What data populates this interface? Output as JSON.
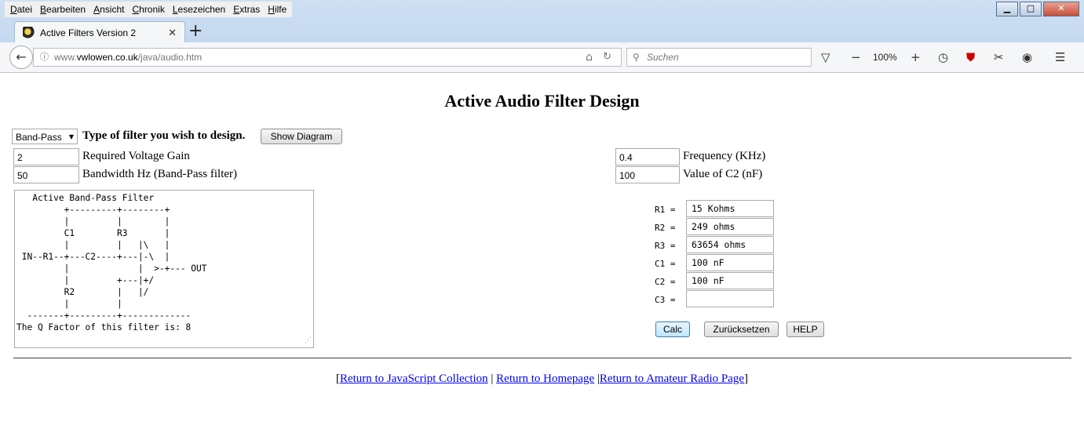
{
  "menu": [
    "Datei",
    "Bearbeiten",
    "Ansicht",
    "Chronik",
    "Lesezeichen",
    "Extras",
    "Hilfe"
  ],
  "window_controls": {
    "minimize": "▁",
    "maximize": "□",
    "close": "✕"
  },
  "tab": {
    "title": "Active Filters Version 2",
    "close": "✕",
    "new_tab": "+"
  },
  "nav": {
    "back_icon": "arrow-left",
    "url_prefix": "www.",
    "url_domain": "vwlowen.co.uk",
    "url_path": "/java/audio.htm",
    "search_placeholder": "Suchen",
    "zoom": "100%",
    "zoom_out": "−",
    "zoom_in": "+"
  },
  "page": {
    "title": "Active Audio Filter Design",
    "filter_type": {
      "selected": "Band-Pass",
      "label": "Type of filter you wish to design."
    },
    "show_diagram": "Show Diagram",
    "gain": {
      "value": "2",
      "label": "Required Voltage Gain"
    },
    "bandwidth": {
      "value": "50",
      "label": "Bandwidth Hz (Band-Pass filter)"
    },
    "frequency": {
      "value": "0.4",
      "label": "Frequency (KHz)"
    },
    "c2_value": {
      "value": "100",
      "label": "Value of C2 (nF)"
    },
    "diagram_text": "   Active Band-Pass Filter\n         +---------+--------+\n         |         |        |\n         C1        R3       |\n         |         |   |\\   |\n IN--R1--+---C2----+---|-\\  |\n         |             |  >-+--- OUT\n         |         +---|+/\n         R2        |   |/\n         |         |\n  -------+---------+-------------\nThe Q Factor of this filter is: 8",
    "results": [
      {
        "label": "R1  =",
        "value": "15  Kohms"
      },
      {
        "label": "R2  =",
        "value": "249  ohms"
      },
      {
        "label": "R3  =",
        "value": "63654  ohms"
      },
      {
        "label": "C1  =",
        "value": "100  nF"
      },
      {
        "label": "C2  =",
        "value": "100  nF"
      },
      {
        "label": "C3  =",
        "value": ""
      }
    ],
    "buttons": {
      "calc": "Calc",
      "reset": "Zurücksetzen",
      "help": "HELP"
    },
    "footer": {
      "open": "[",
      "link1": "Return to JavaScript Collection",
      "sep1": " | ",
      "link2": "Return to Homepage",
      "sep2": " |",
      "link3": "Return to Amateur Radio Page",
      "close": "]"
    }
  }
}
